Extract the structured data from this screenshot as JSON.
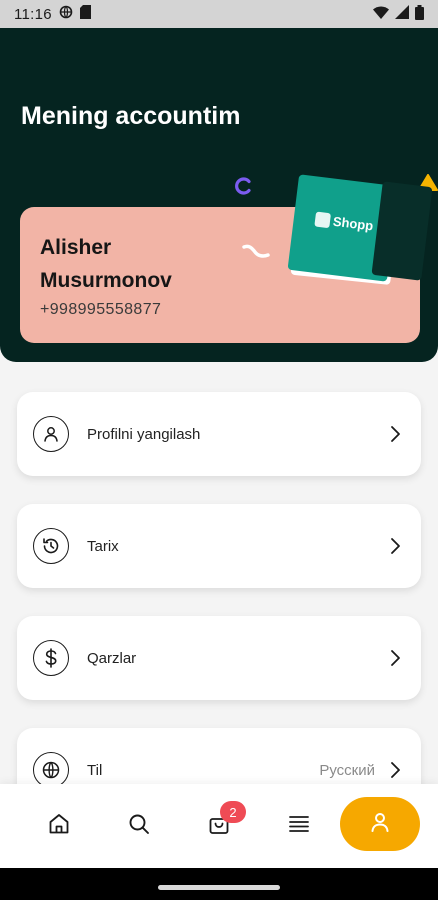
{
  "status_bar": {
    "time": "11:16"
  },
  "header": {
    "title": "Mening accountim"
  },
  "card": {
    "name_line1": "Alisher",
    "name_line2": "Musurmonov",
    "phone": "+998995558877",
    "bag_logo_text": "Shopp"
  },
  "menu": {
    "items": [
      {
        "label": "Profilni yangilash",
        "icon": "user-icon"
      },
      {
        "label": "Tarix",
        "icon": "history-icon"
      },
      {
        "label": "Qarzlar",
        "icon": "dollar-icon"
      },
      {
        "label": "Til",
        "value": "Русский",
        "icon": "globe-icon"
      }
    ]
  },
  "bottom_nav": {
    "cart_badge": "2",
    "items": [
      "home-icon",
      "search-icon",
      "cart-icon",
      "menu-icon",
      "profile-icon"
    ],
    "active": "profile-icon"
  },
  "colors": {
    "header_bg": "#052420",
    "card_bg": "#f2b4a6",
    "accent": "#f6a800",
    "badge": "#ef4b55",
    "bag_green": "#10a08b"
  }
}
